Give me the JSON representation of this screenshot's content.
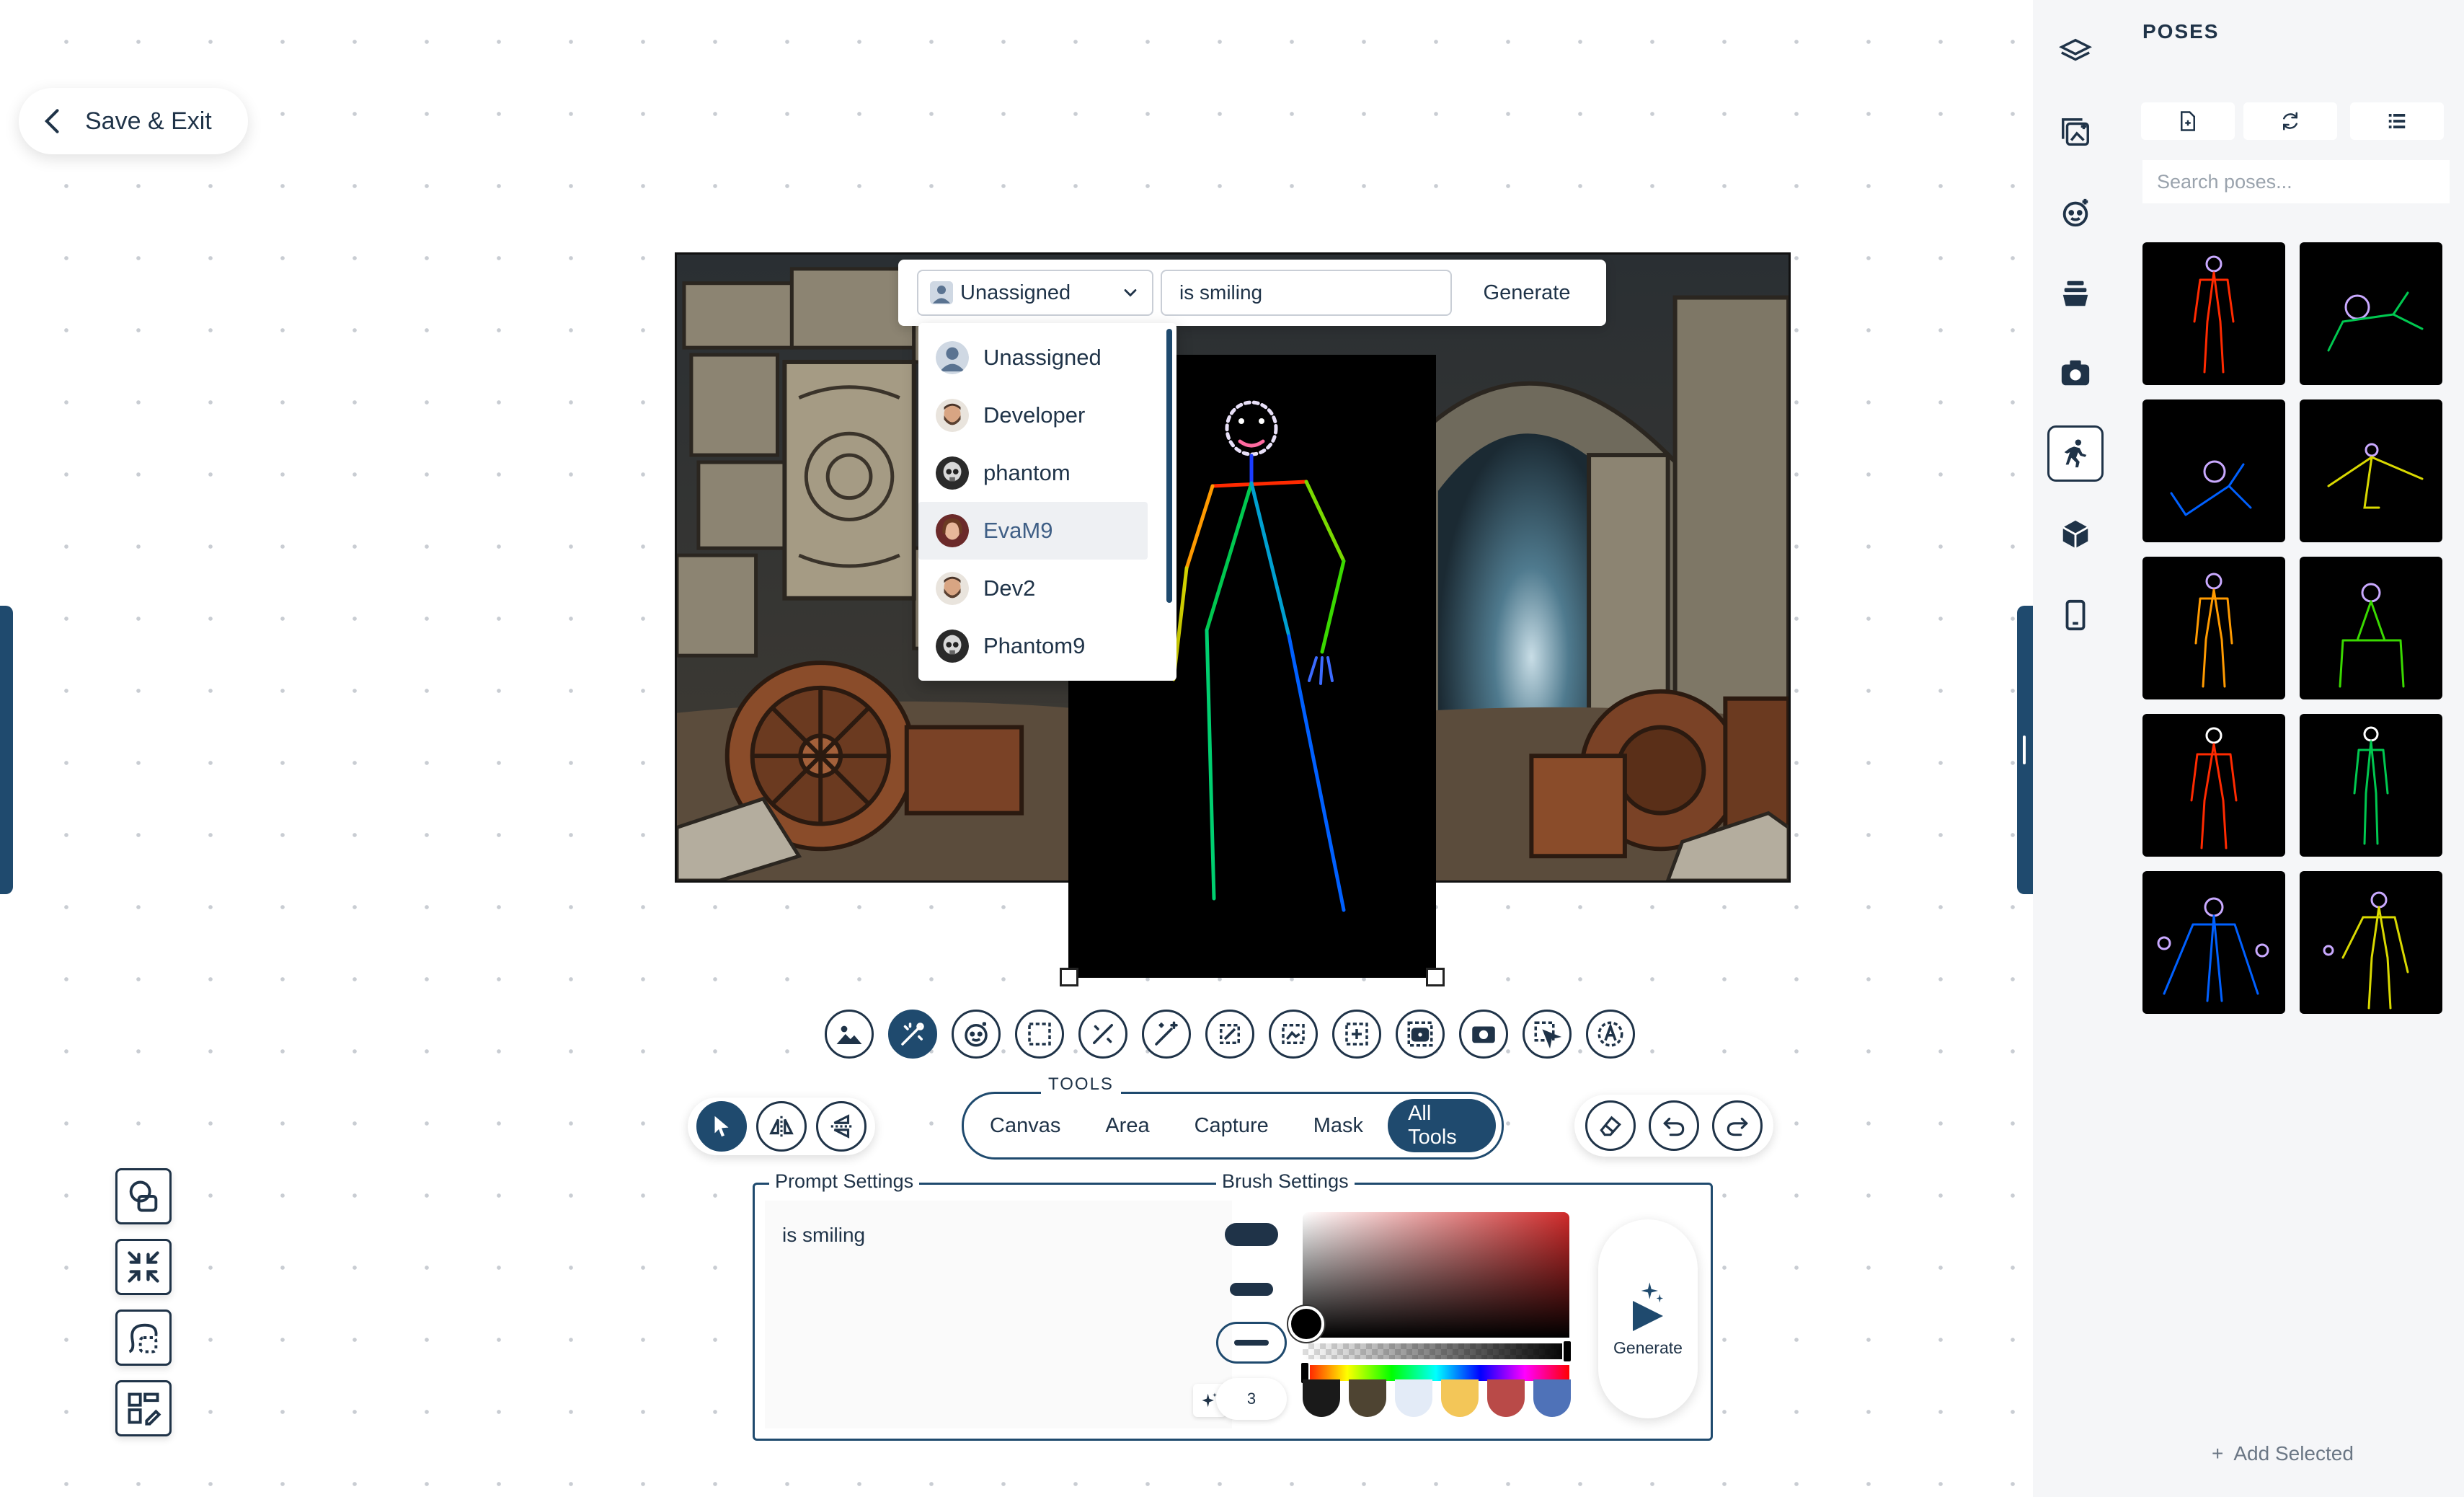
{
  "header": {
    "save_exit_label": "Save & Exit"
  },
  "prompt_bar": {
    "assignee_value": "Unassigned",
    "prompt_value": "is smiling",
    "generate_label": "Generate"
  },
  "assignee_dropdown": {
    "items": [
      {
        "label": "Unassigned",
        "avatar": "generic-user-icon"
      },
      {
        "label": "Developer",
        "avatar": "bearded-man-avatar"
      },
      {
        "label": "phantom",
        "avatar": "skull-avatar"
      },
      {
        "label": "EvaM9",
        "avatar": "woman-avatar",
        "highlighted": true
      },
      {
        "label": "Dev2",
        "avatar": "bearded-man-avatar"
      },
      {
        "label": "Phantom9",
        "avatar": "skull-avatar"
      }
    ]
  },
  "tool_icons": [
    "image-icon",
    "pose-brush-icon",
    "face-icon",
    "area-select-icon",
    "inpaint-brush-icon",
    "magic-wand-icon",
    "crop-icon",
    "landscape-icon",
    "expand-icon",
    "camera-frame-icon",
    "capture-icon",
    "cursor-select-icon",
    "text-style-icon"
  ],
  "mode_buttons": [
    "select-arrow-icon",
    "flip-horizontal-icon",
    "flip-vertical-icon"
  ],
  "tools": {
    "label": "TOOLS",
    "tabs": [
      "Canvas",
      "Area",
      "Capture",
      "Mask",
      "All Tools"
    ],
    "active_tab": "All Tools"
  },
  "history_buttons": [
    "eraser-icon",
    "undo-icon",
    "redo-icon"
  ],
  "prompt_settings": {
    "legend": "Prompt Settings",
    "text": "is smiling"
  },
  "brush_settings": {
    "legend": "Brush Settings",
    "size_value": "3",
    "swatches": [
      "#1a1a1a",
      "#4e4432",
      "#e3ebf7",
      "#f3c658",
      "#b94a48",
      "#4f72b8"
    ],
    "accent": "#1f4a6e"
  },
  "generate_main_label": "Generate",
  "left_tools": [
    "shapes-icon",
    "shrink-icon",
    "lasso-icon",
    "layout-edit-icon"
  ],
  "rail_icons": [
    "layers-icon",
    "gallery-add-icon",
    "face-add-icon",
    "stack-icon",
    "camera-icon",
    "pose-run-icon",
    "cube-icon",
    "phone-icon"
  ],
  "poses_panel": {
    "title": "POSES",
    "tabs": [
      "new-file-icon",
      "refresh-icon",
      "list-icon"
    ],
    "search_placeholder": "Search poses...",
    "add_selected_label": "Add Selected",
    "thumbnail_count": 10
  }
}
